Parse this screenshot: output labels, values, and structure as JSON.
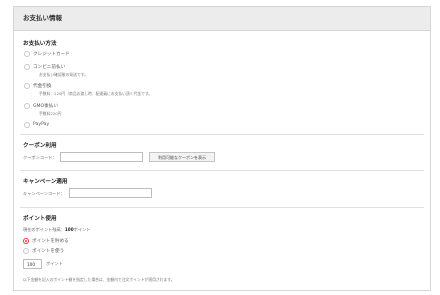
{
  "header": {
    "title": "お支払い情報"
  },
  "payment": {
    "heading": "お支払い方法",
    "options": [
      {
        "label": "クレジットカード",
        "note": ""
      },
      {
        "label": "コンビニ前払い",
        "note": "お支払い確認後の発送です。"
      },
      {
        "label": "代金引換",
        "note": "手数料：220円（商品お渡し時、配達員にお支払い頂く代金です。"
      },
      {
        "label": "GMO後払い",
        "note": "手数料220円"
      },
      {
        "label": "PayPay",
        "note": ""
      }
    ]
  },
  "coupon": {
    "heading": "クーポン利用",
    "label": "クーポンコード：",
    "value": "",
    "show_button": "利用可能なクーポンを表示"
  },
  "campaign": {
    "heading": "キャンペーン適用",
    "label": "キャンペーンコード：",
    "value": ""
  },
  "points": {
    "heading": "ポイント使用",
    "owned_label": "現在のポイント残高：",
    "owned_value": "100",
    "owned_unit": "ポイント",
    "option_use_all": "ポイントを貯める",
    "option_use": "ポイントを使う",
    "amount_value": "100",
    "amount_unit": "ポイント",
    "note": "以下金額を記入のポイント額を指定した場合は、金額内で注文ポイントが適用されます。"
  },
  "colors": {
    "accent": "#e53935",
    "header_bg": "#ececec",
    "border": "#d6d6d6"
  }
}
